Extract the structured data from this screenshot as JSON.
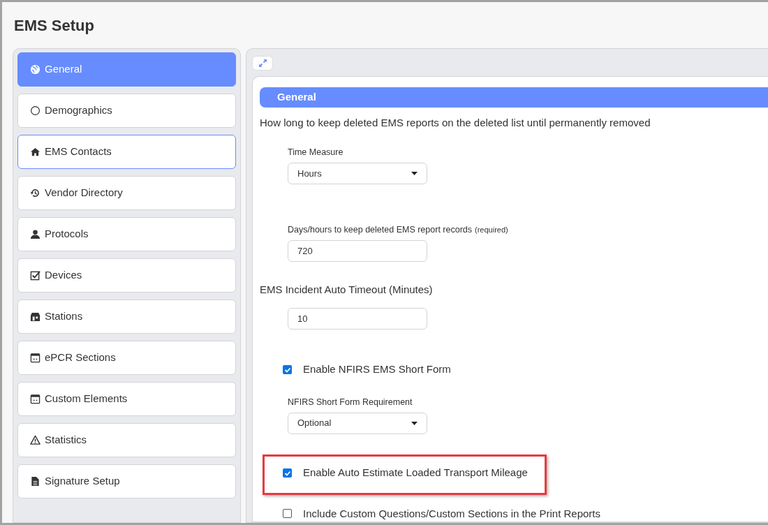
{
  "title": "EMS Setup",
  "sidebar": {
    "items": [
      {
        "label": "General",
        "selected": true,
        "focused": false
      },
      {
        "label": "Demographics",
        "selected": false,
        "focused": false
      },
      {
        "label": "EMS Contacts",
        "selected": false,
        "focused": true
      },
      {
        "label": "Vendor Directory",
        "selected": false,
        "focused": false
      },
      {
        "label": "Protocols",
        "selected": false,
        "focused": false
      },
      {
        "label": "Devices",
        "selected": false,
        "focused": false
      },
      {
        "label": "Stations",
        "selected": false,
        "focused": false
      },
      {
        "label": "ePCR Sections",
        "selected": false,
        "focused": false
      },
      {
        "label": "Custom Elements",
        "selected": false,
        "focused": false
      },
      {
        "label": "Statistics",
        "selected": false,
        "focused": false
      },
      {
        "label": "Signature Setup",
        "selected": false,
        "focused": false
      }
    ]
  },
  "main": {
    "section_title": "General",
    "fields": [
      {
        "kind": "text",
        "text": "How long to keep deleted EMS reports on the deleted list until permanently removed"
      },
      {
        "kind": "select",
        "label": "Time Measure",
        "value": "Hours"
      },
      {
        "kind": "input",
        "label": "Days/hours to keep deleted EMS report records",
        "note": "(required)",
        "value": "720"
      },
      {
        "kind": "text",
        "text": "EMS Incident Auto Timeout (Minutes)"
      },
      {
        "kind": "input",
        "value": "10"
      },
      {
        "kind": "checkbox",
        "label": "Enable NFIRS EMS Short Form",
        "checked": true,
        "highlighted": false
      },
      {
        "kind": "select",
        "label": "NFIRS Short Form Requirement",
        "value": "Optional"
      },
      {
        "kind": "checkbox",
        "label": "Enable Auto Estimate Loaded Transport Mileage",
        "checked": true,
        "highlighted": true
      },
      {
        "kind": "checkbox",
        "label": "Include Custom Questions/Custom Sections in the Print Reports",
        "checked": false,
        "highlighted": false
      }
    ]
  }
}
